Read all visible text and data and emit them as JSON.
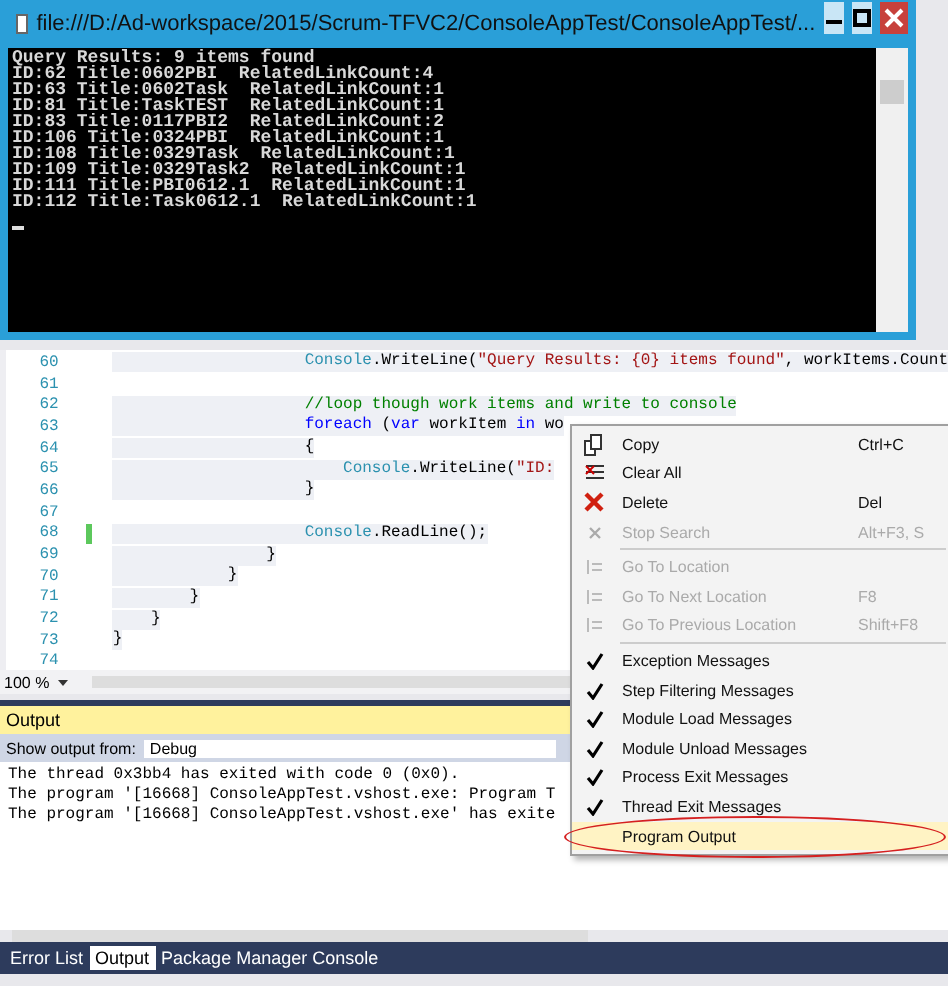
{
  "console_window": {
    "title": "file:///D:/Ad-workspace/2015/Scrum-TFVC2/ConsoleAppTest/ConsoleAppTest/...",
    "lines": [
      "Query Results: 9 items found",
      "ID:62 Title:0602PBI  RelatedLinkCount:4",
      "ID:63 Title:0602Task  RelatedLinkCount:1",
      "ID:81 Title:TaskTEST  RelatedLinkCount:1",
      "ID:83 Title:0117PBI2  RelatedLinkCount:2",
      "ID:106 Title:0324PBI  RelatedLinkCount:1",
      "ID:108 Title:0329Task  RelatedLinkCount:1",
      "ID:109 Title:0329Task2  RelatedLinkCount:1",
      "ID:111 Title:PBI0612.1  RelatedLinkCount:1",
      "ID:112 Title:Task0612.1  RelatedLinkCount:1"
    ]
  },
  "editor": {
    "lines": [
      {
        "number": "60",
        "changed": false,
        "tokens": [
          {
            "kind": "type",
            "text": "                    Console"
          },
          {
            "kind": "plain",
            "text": ".WriteLine("
          },
          {
            "kind": "string",
            "text": "\"Query Results: {0} items found\""
          },
          {
            "kind": "plain",
            "text": ", workItems.Count"
          }
        ]
      },
      {
        "number": "61",
        "changed": false
      },
      {
        "number": "62",
        "changed": false,
        "tokens": [
          {
            "kind": "comment",
            "text": "                    //loop though work items and write to console"
          }
        ]
      },
      {
        "number": "63",
        "changed": false,
        "tokens": [
          {
            "kind": "keyword",
            "text": "                    foreach"
          },
          {
            "kind": "plain",
            "text": " ("
          },
          {
            "kind": "keyword",
            "text": "var"
          },
          {
            "kind": "plain",
            "text": " workItem "
          },
          {
            "kind": "keyword",
            "text": "in"
          },
          {
            "kind": "plain",
            "text": " wo"
          }
        ]
      },
      {
        "number": "64",
        "changed": false,
        "tokens": [
          {
            "kind": "plain",
            "text": "                    {"
          }
        ]
      },
      {
        "number": "65",
        "changed": false,
        "tokens": [
          {
            "kind": "type",
            "text": "                        Console"
          },
          {
            "kind": "plain",
            "text": ".WriteLine("
          },
          {
            "kind": "string",
            "text": "\"ID:"
          }
        ]
      },
      {
        "number": "66",
        "changed": false,
        "tokens": [
          {
            "kind": "plain",
            "text": "                    }"
          }
        ]
      },
      {
        "number": "67",
        "changed": false
      },
      {
        "number": "68",
        "changed": true,
        "tokens": [
          {
            "kind": "type",
            "text": "                    Console"
          },
          {
            "kind": "plain",
            "text": ".ReadLine();"
          }
        ]
      },
      {
        "number": "69",
        "changed": false,
        "tokens": [
          {
            "kind": "plain",
            "text": "                }"
          }
        ]
      },
      {
        "number": "70",
        "changed": false,
        "tokens": [
          {
            "kind": "plain",
            "text": "            }"
          }
        ]
      },
      {
        "number": "71",
        "changed": false,
        "tokens": [
          {
            "kind": "plain",
            "text": "        }"
          }
        ]
      },
      {
        "number": "72",
        "changed": false,
        "tokens": [
          {
            "kind": "plain",
            "text": "    }"
          }
        ]
      },
      {
        "number": "73",
        "changed": false,
        "tokens": [
          {
            "kind": "plain",
            "text": "}"
          }
        ]
      },
      {
        "number": "74",
        "changed": false
      }
    ],
    "zoom": "100 %"
  },
  "output_panel": {
    "title": "Output",
    "source_label": "Show output from:",
    "source_value": "Debug",
    "lines": [
      "The thread 0x3bb4 has exited with code 0 (0x0).",
      "The program '[16668] ConsoleAppTest.vshost.exe: Program T",
      "The program '[16668] ConsoleAppTest.vshost.exe' has exite"
    ]
  },
  "bottom_tabs": [
    {
      "label": "Error List",
      "selected": false
    },
    {
      "label": "Output",
      "selected": true
    },
    {
      "label": "Package Manager Console",
      "selected": false
    }
  ],
  "context_menu": {
    "groups": [
      [
        {
          "label": "Copy",
          "shortcut": "Ctrl+C",
          "kind": "copy",
          "disabled": false,
          "selected": false
        },
        {
          "label": "Clear All",
          "kind": "clear",
          "disabled": false,
          "selected": false
        },
        {
          "label": "Delete",
          "shortcut": "Del",
          "kind": "delete",
          "disabled": false,
          "selected": false
        },
        {
          "label": "Stop Search",
          "shortcut": "Alt+F3, S",
          "kind": "stop",
          "disabled": true,
          "selected": false
        }
      ],
      [
        {
          "label": "Go To Location",
          "kind": "goto",
          "disabled": true,
          "selected": false
        },
        {
          "label": "Go To Next Location",
          "shortcut": "F8",
          "kind": "goto",
          "disabled": true,
          "selected": false
        },
        {
          "label": "Go To Previous Location",
          "shortcut": "Shift+F8",
          "kind": "goto",
          "disabled": true,
          "selected": false
        }
      ],
      [
        {
          "label": "Exception Messages",
          "kind": "toggle",
          "disabled": false,
          "checked": true,
          "selected": false
        },
        {
          "label": "Step Filtering Messages",
          "kind": "toggle",
          "disabled": false,
          "checked": true,
          "selected": false
        },
        {
          "label": "Module Load Messages",
          "kind": "toggle",
          "disabled": false,
          "checked": true,
          "selected": false
        },
        {
          "label": "Module Unload Messages",
          "kind": "toggle",
          "disabled": false,
          "checked": true,
          "selected": false
        },
        {
          "label": "Process Exit Messages",
          "kind": "toggle",
          "disabled": false,
          "checked": true,
          "selected": false
        },
        {
          "label": "Thread Exit Messages",
          "kind": "toggle",
          "disabled": false,
          "checked": true,
          "selected": false
        },
        {
          "label": "Program Output",
          "kind": "toggle",
          "disabled": false,
          "checked": false,
          "selected": true
        }
      ]
    ]
  }
}
